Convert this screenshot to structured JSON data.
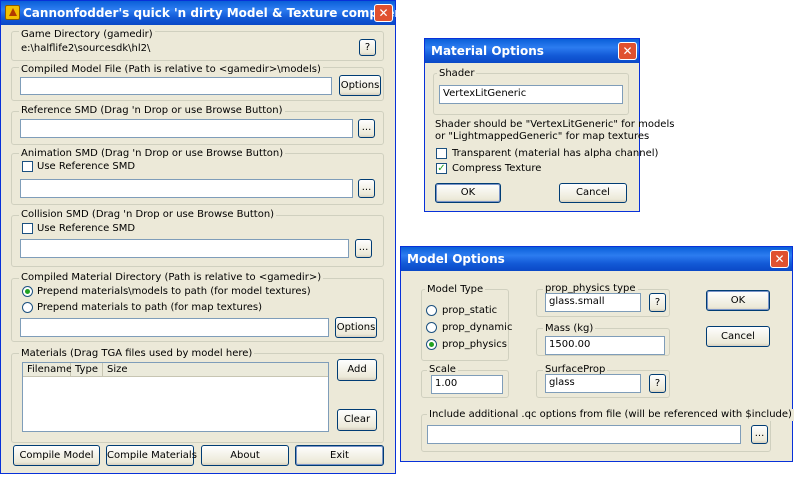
{
  "compiler": {
    "title": "Cannonfodder's quick 'n dirty Model & Texture compiler",
    "game_dir": {
      "label": "Game Directory (gamedir)",
      "value": "e:\\halflife2\\sourcesdk\\hl2\\",
      "help": "?"
    },
    "compiled_model": {
      "label": "Compiled Model File (Path is relative to <gamedir>\\models)",
      "value": "",
      "options": "Options"
    },
    "reference_smd": {
      "label": "Reference SMD (Drag 'n Drop or use Browse Button)",
      "value": "",
      "browse": "..."
    },
    "animation_smd": {
      "label": "Animation SMD (Drag 'n Drop or use Browse Button)",
      "use_ref": "Use Reference SMD",
      "use_ref_checked": false,
      "value": "",
      "browse": "..."
    },
    "collision_smd": {
      "label": "Collision SMD (Drag 'n Drop or use Browse Button)",
      "use_ref": "Use Reference SMD",
      "use_ref_checked": false,
      "value": "",
      "browse": "..."
    },
    "material_dir": {
      "label": "Compiled Material Directory (Path is relative to <gamedir>)",
      "opt1": "Prepend materials\\models to path (for model textures)",
      "opt2": "Prepend materials to path (for map textures)",
      "selected": "opt1",
      "value": "",
      "options": "Options"
    },
    "materials": {
      "label": "Materials (Drag TGA files used by model here)",
      "columns": [
        "Filename",
        "Type",
        "Size"
      ],
      "add": "Add",
      "clear": "Clear"
    },
    "buttons": {
      "compile_model": "Compile Model",
      "compile_materials": "Compile Materials",
      "about": "About",
      "exit": "Exit"
    }
  },
  "material_options": {
    "title": "Material Options",
    "shader_label": "Shader",
    "shader_value": "VertexLitGeneric",
    "hint_line1": "Shader should be \"VertexLitGeneric\" for models",
    "hint_line2": "or \"LightmappedGeneric\" for map textures",
    "transparent": "Transparent (material has alpha channel)",
    "transparent_checked": false,
    "compress": "Compress Texture",
    "compress_checked": true,
    "ok": "OK",
    "cancel": "Cancel"
  },
  "model_options": {
    "title": "Model Options",
    "model_type_label": "Model Type",
    "types": [
      "prop_static",
      "prop_dynamic",
      "prop_physics"
    ],
    "selected_type": "prop_physics",
    "physics_type_label": "prop_physics type",
    "physics_type_value": "glass.small",
    "mass_label": "Mass (kg)",
    "mass_value": "1500.00",
    "scale_label": "Scale",
    "scale_value": "1.00",
    "surfaceprop_label": "SurfaceProp",
    "surfaceprop_value": "glass",
    "help": "?",
    "include_label": "Include additional .qc options from file (will be referenced with $include)",
    "include_value": "",
    "browse": "...",
    "ok": "OK",
    "cancel": "Cancel"
  }
}
